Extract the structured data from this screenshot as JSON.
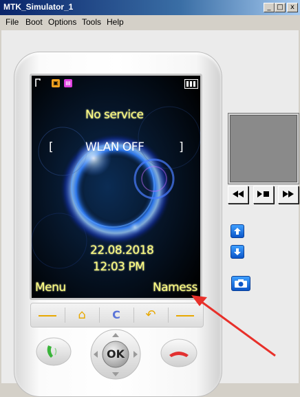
{
  "window": {
    "title": "MTK_Simulator_1",
    "controls": {
      "minimize": "_",
      "maximize": "□",
      "close": "x"
    }
  },
  "menu": [
    "File",
    "Boot",
    "Options",
    "Tools",
    "Help"
  ],
  "phone": {
    "status": {
      "icons": [
        "signal-icon",
        "sim-card-icon",
        "memory-card-icon",
        "battery-icon"
      ]
    },
    "screen": {
      "network": "No service",
      "wlan_left_bracket": "[",
      "wlan_status": "WLAN OFF",
      "wlan_right_bracket": "]",
      "date": "22.08.2018",
      "time": "12:03 PM",
      "left_softkey": "Menu",
      "right_softkey": "Namess"
    },
    "keys": {
      "home_glyph": "⌂",
      "clear_glyph": "C",
      "back_glyph": "↶",
      "ok": "OK"
    }
  },
  "side_panel": {
    "media_buttons": [
      "rewind",
      "play-stop",
      "fast-forward"
    ],
    "icons": [
      "up-icon",
      "down-icon",
      "camera-icon"
    ]
  },
  "colors": {
    "screen_text": "#ffff80",
    "title_bar": "#0a246a",
    "annotation_arrow": "#e8302a"
  }
}
